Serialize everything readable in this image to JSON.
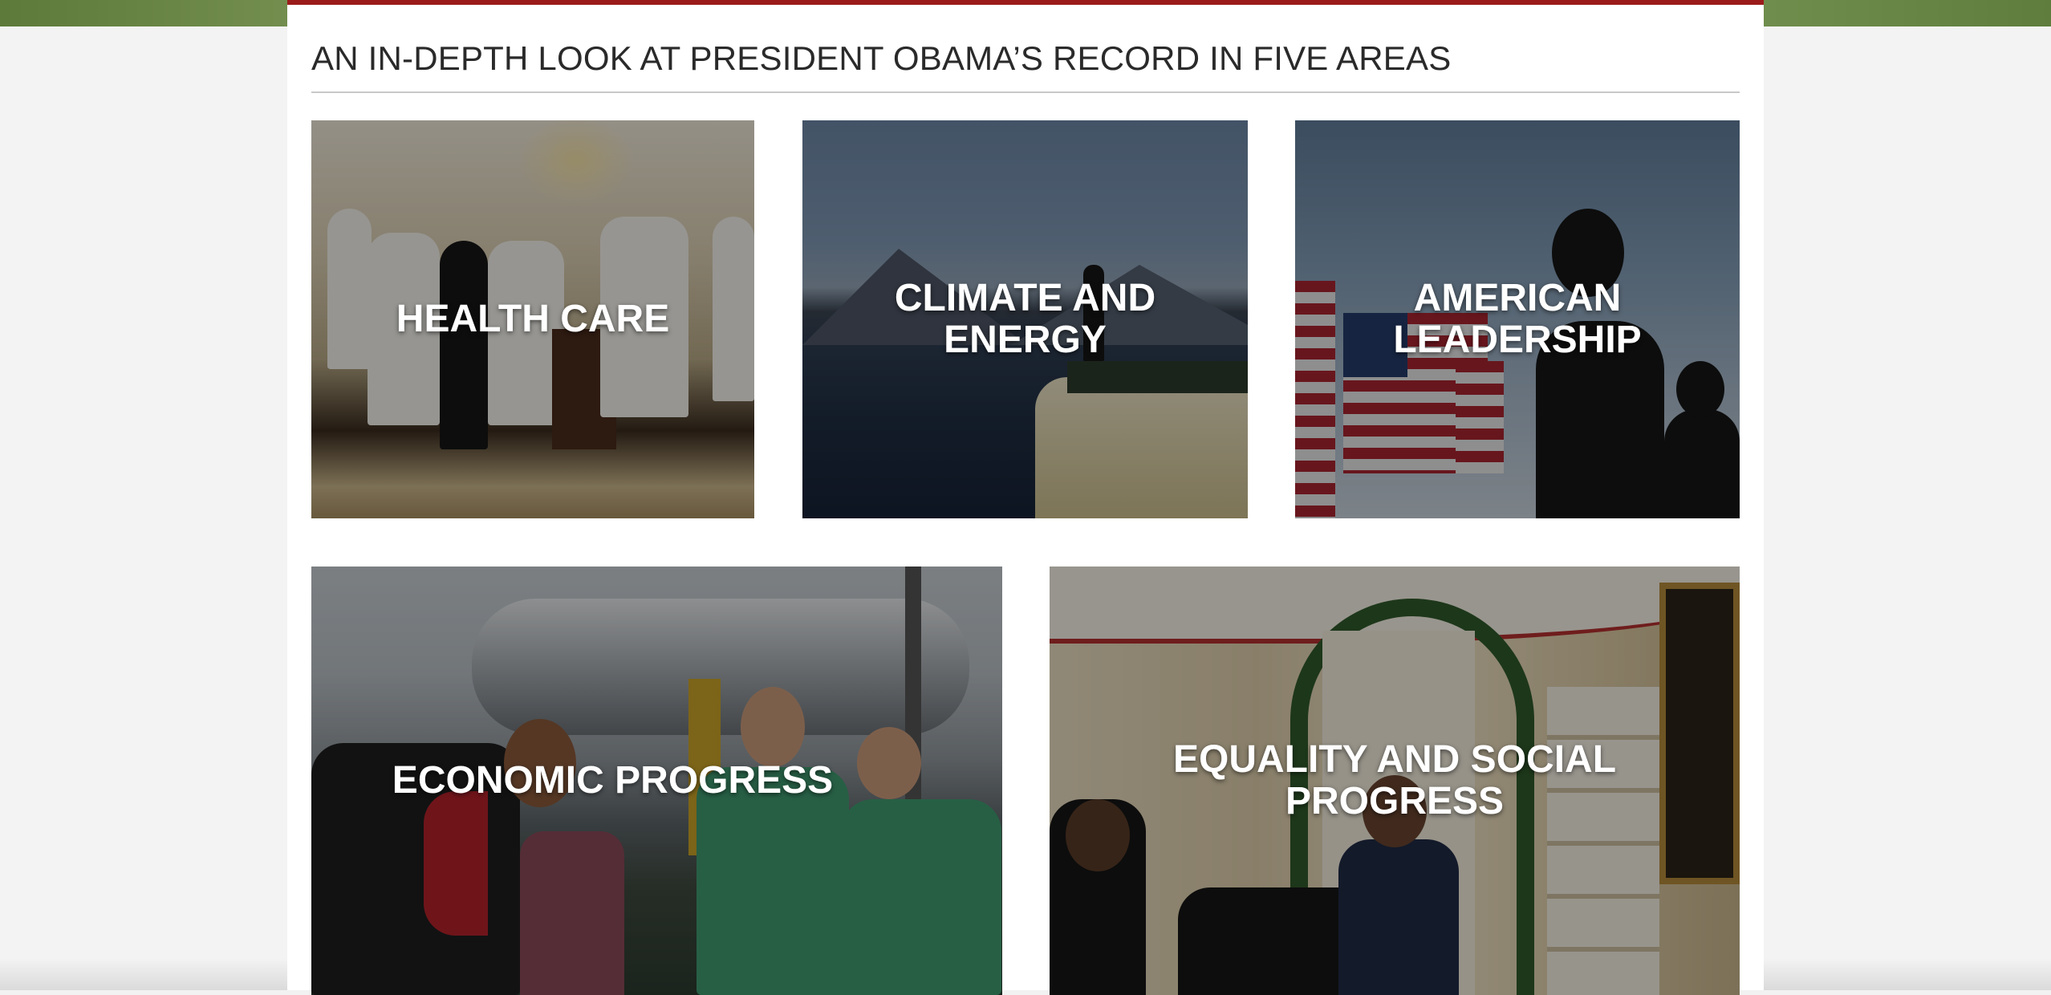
{
  "page": {
    "section_title": "AN IN-DEPTH LOOK AT PRESIDENT OBAMA’S RECORD IN FIVE AREAS"
  },
  "colors": {
    "accent_bar": "#9b1b1b",
    "page_background": "#f3f3f3",
    "panel_background": "#ffffff",
    "title_text": "#2a2a2a",
    "card_label": "#ffffff"
  },
  "cards": [
    {
      "id": "health-care",
      "label": "HEALTH CARE"
    },
    {
      "id": "climate-energy",
      "label": "CLIMATE AND ENERGY"
    },
    {
      "id": "american-leadership",
      "label": "AMERICAN LEADERSHIP"
    },
    {
      "id": "economic-progress",
      "label": "ECONOMIC PROGRESS"
    },
    {
      "id": "equality-social-progress",
      "label": "EQUALITY AND SOCIAL PROGRESS"
    }
  ]
}
